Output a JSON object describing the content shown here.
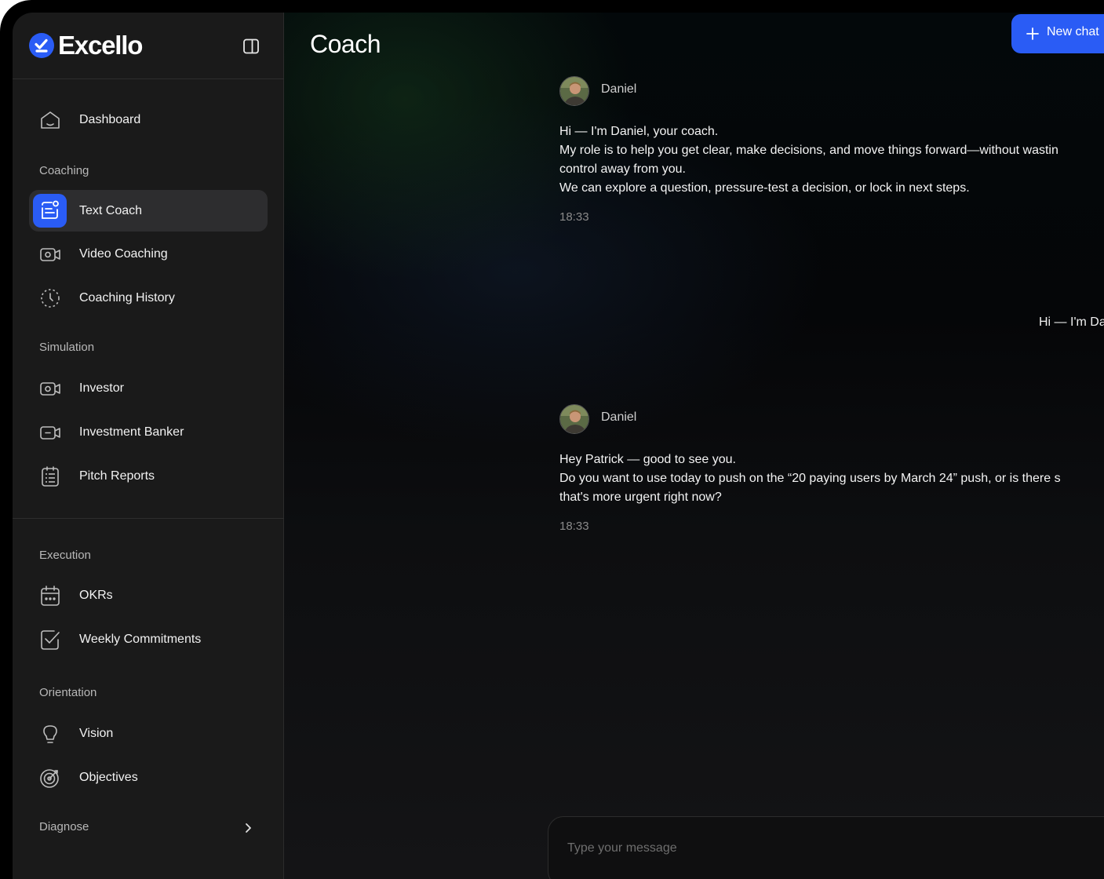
{
  "app": {
    "name": "Excello",
    "brand_color": "#2a5cf5"
  },
  "sidebar": {
    "top_item": {
      "label": "Dashboard",
      "icon": "home-icon"
    },
    "sections": [
      {
        "title": "Coaching",
        "items": [
          {
            "label": "Text Coach",
            "icon": "chat-icon",
            "active": true
          },
          {
            "label": "Video Coaching",
            "icon": "video-icon"
          },
          {
            "label": "Coaching History",
            "icon": "history-icon"
          }
        ]
      },
      {
        "title": "Simulation",
        "items": [
          {
            "label": "Investor",
            "icon": "video-icon"
          },
          {
            "label": "Investment Banker",
            "icon": "video-off-icon"
          },
          {
            "label": "Pitch Reports",
            "icon": "clipboard-icon"
          }
        ]
      },
      {
        "title": "Execution",
        "items": [
          {
            "label": "OKRs",
            "icon": "calendar-icon"
          },
          {
            "label": "Weekly Commitments",
            "icon": "checkbox-icon"
          }
        ]
      },
      {
        "title": "Orientation",
        "items": [
          {
            "label": "Vision",
            "icon": "lightbulb-icon"
          },
          {
            "label": "Objectives",
            "icon": "target-icon"
          }
        ]
      },
      {
        "title": "Diagnose",
        "items": []
      }
    ]
  },
  "header": {
    "title": "Coach",
    "new_chat_label": "New chat"
  },
  "messages": [
    {
      "sender": "Daniel",
      "lines": [
        "Hi — I'm Daniel, your coach.",
        "My role is to help you get clear, make decisions, and move things forward—without wastin",
        "control away from you.",
        "We can explore a question, pressure-test a decision, or lock in next steps."
      ],
      "time": "18:33"
    },
    {
      "sender": "user",
      "text": "Hi — I'm Da"
    },
    {
      "sender": "Daniel",
      "lines": [
        "Hey Patrick — good to see you.",
        "Do you want to use today to push on the “20 paying users by March 24” push, or is there s",
        "that's more urgent right now?"
      ],
      "time": "18:33"
    }
  ],
  "composer": {
    "placeholder": "Type your message"
  }
}
